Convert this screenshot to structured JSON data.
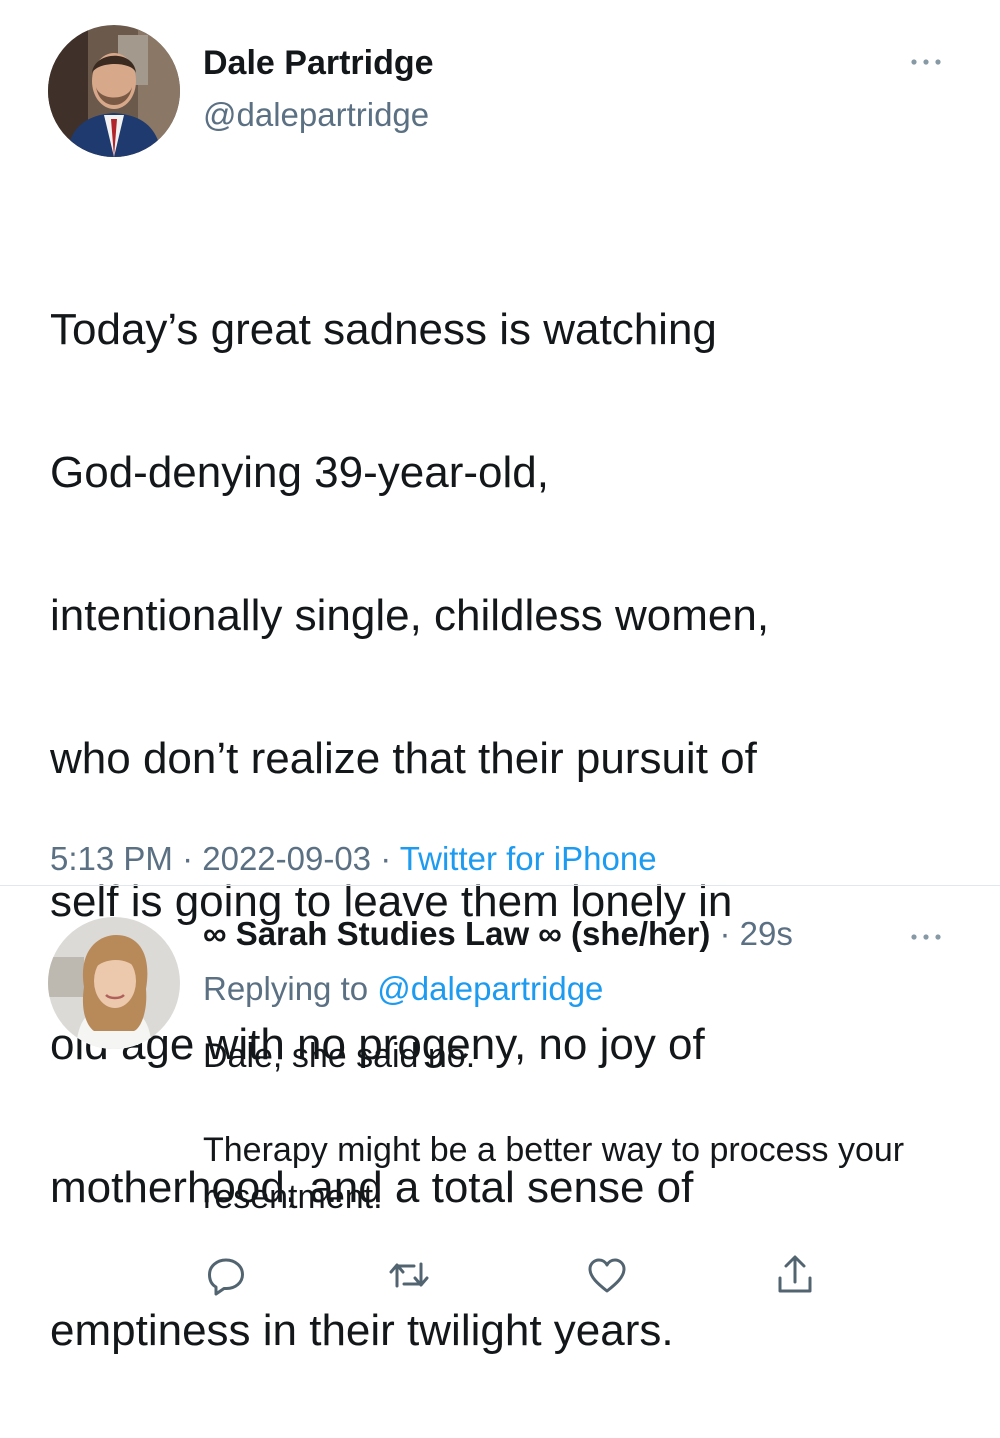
{
  "tweet": {
    "author_name": "Dale Partridge",
    "author_handle": "@dalepartridge",
    "lines": [
      "Today’s great sadness is watching",
      "God-denying 39-year-old,",
      "intentionally single, childless women,",
      "who don’t realize that their pursuit of",
      "self is going to leave them lonely in",
      "old age with no progeny, no joy of",
      "motherhood, and a total sense of",
      "emptiness in their twilight years."
    ],
    "time": "5:13 PM",
    "separator": " · ",
    "date": "2022-09-03",
    "source": "Twitter for iPhone"
  },
  "reply": {
    "display_name": "∞ Sarah Studies Law ∞ (she/her)",
    "separator": " · ",
    "time_ago": "29s",
    "replying_prefix": "Replying to ",
    "replying_handle": "@dalepartridge",
    "body_p1": "Dale, she said no.",
    "body_p2": "Therapy might be a better way to process your resentment."
  },
  "icons": {
    "more": "more-horizontal-icon",
    "reply": "reply-bubble-icon",
    "retweet": "retweet-icon",
    "like": "heart-icon",
    "share": "share-icon"
  },
  "colors": {
    "text": "#14171a",
    "secondary": "#5b7083",
    "link": "#1d9bf0",
    "divider": "#e1e8ed"
  }
}
